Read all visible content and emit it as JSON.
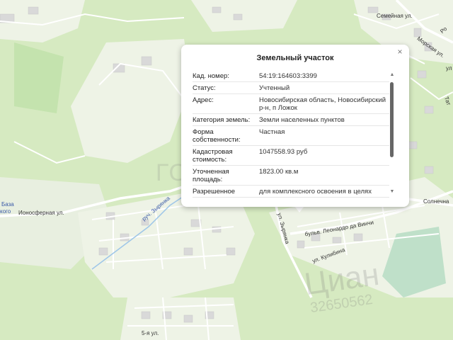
{
  "popup": {
    "title": "Земельный участок",
    "close_symbol": "×",
    "rows": [
      {
        "key": "Кад. номер:",
        "value": "54:19:164603:3399"
      },
      {
        "key": "Статус:",
        "value": "Учтенный"
      },
      {
        "key": "Адрес:",
        "value": "Новосибирская область, Новосибирский р-н, п Ложок"
      },
      {
        "key": "Категория земель:",
        "value": "Земли населенных пунктов"
      },
      {
        "key": "Форма собственности:",
        "value": "Частная"
      },
      {
        "key": "Кадастровая стоимость:",
        "value": "1047558.93 руб"
      },
      {
        "key": "Уточненная площадь:",
        "value": "1823.00 кв.м"
      },
      {
        "key": "Разрешенное",
        "value": "для комплексного освоения в целях"
      }
    ],
    "scroll_up_symbol": "▲",
    "scroll_down_symbol": "▼"
  },
  "streets": {
    "semeinaya": "Семейная ул.",
    "morskaya": "Морская ул.",
    "ionosfernaya": "Ионосферная ул.",
    "zyryanka": "руч. Зырянка",
    "zyryanka_street": "ул. Зырянка",
    "leonardo": "бульв. Леонардо да Винчи",
    "kulibina": "ул. Кулибина",
    "solnechnaya": "Солнечна",
    "pyataya": "5-я ул.",
    "baza": "База",
    "cut_left": "кого",
    "cut_right_a": "Ро",
    "cut_right_b": "ул",
    "cut_right_c": "Тат"
  },
  "watermarks": {
    "gorod": "ГОРОДА",
    "cian": "Циан",
    "phone": "32650562"
  }
}
